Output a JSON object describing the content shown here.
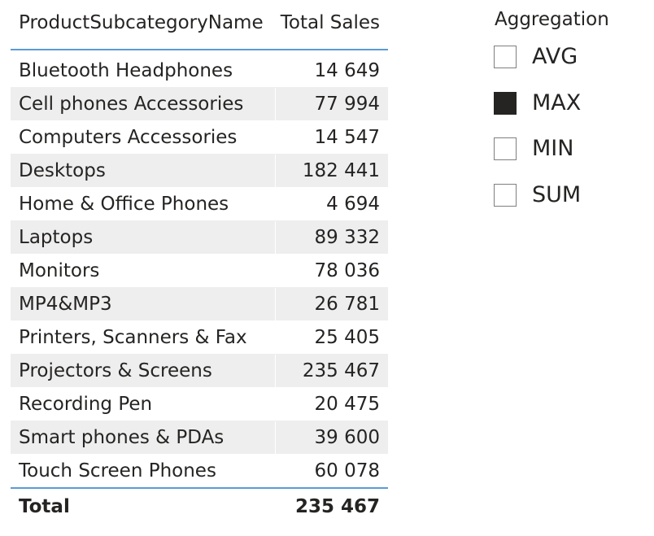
{
  "table": {
    "headers": {
      "name": "ProductSubcategoryName",
      "value": "Total Sales"
    },
    "rows": [
      {
        "name": "Bluetooth Headphones",
        "value": "14 649"
      },
      {
        "name": "Cell phones Accessories",
        "value": "77 994"
      },
      {
        "name": "Computers Accessories",
        "value": "14 547"
      },
      {
        "name": "Desktops",
        "value": "182 441"
      },
      {
        "name": "Home & Office Phones",
        "value": "4 694"
      },
      {
        "name": "Laptops",
        "value": "89 332"
      },
      {
        "name": "Monitors",
        "value": "78 036"
      },
      {
        "name": "MP4&MP3",
        "value": "26 781"
      },
      {
        "name": "Printers, Scanners & Fax",
        "value": "25 405"
      },
      {
        "name": "Projectors & Screens",
        "value": "235 467"
      },
      {
        "name": "Recording Pen",
        "value": "20 475"
      },
      {
        "name": "Smart phones & PDAs",
        "value": "39 600"
      },
      {
        "name": "Touch Screen Phones",
        "value": "60 078"
      }
    ],
    "total": {
      "label": "Total",
      "value": "235 467"
    },
    "colors": {
      "header_rule": "#5b9bd5",
      "alt_row_bg": "#eeeeee",
      "text": "#252423"
    }
  },
  "slicer": {
    "title": "Aggregation",
    "options": [
      {
        "label": "AVG",
        "checked": false
      },
      {
        "label": "MAX",
        "checked": true
      },
      {
        "label": "MIN",
        "checked": false
      },
      {
        "label": "SUM",
        "checked": false
      }
    ]
  }
}
